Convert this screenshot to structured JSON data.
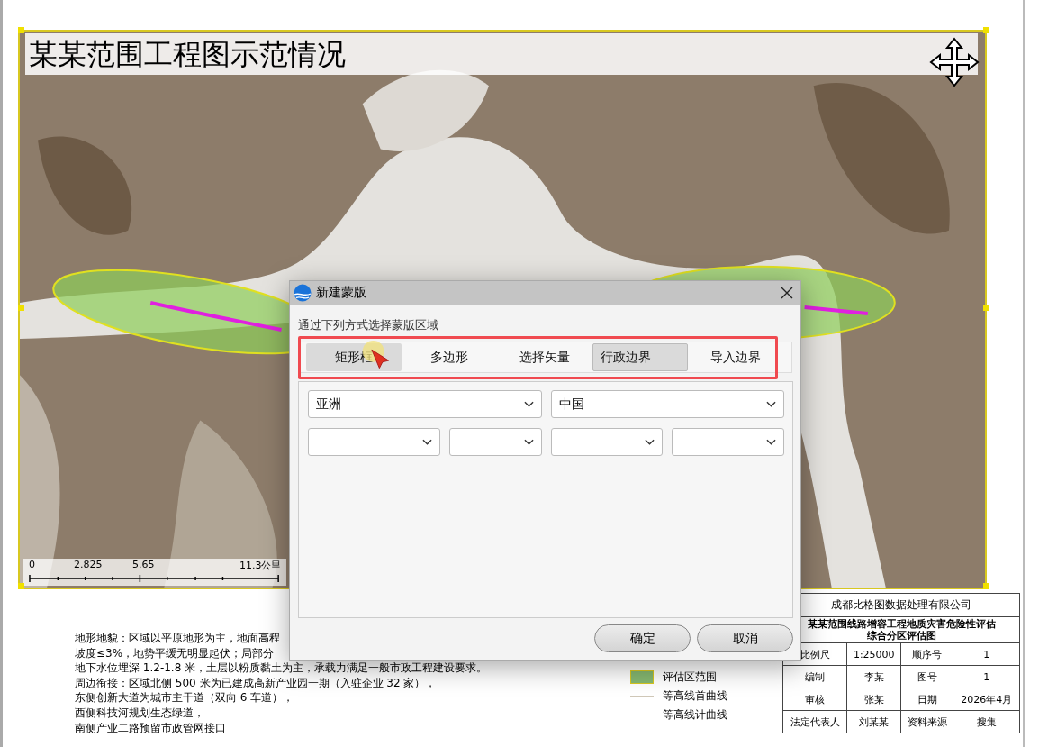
{
  "map_frame": {
    "title": "某某范围工程图示范情况",
    "scale_labels": [
      "0",
      "2.825",
      "5.65",
      "11.3公里"
    ]
  },
  "description": [
    "地形地貌：区域以平原地形为主，地面高程",
    "坡度≤3%，地势平缓无明显起伏；局部分",
    "地下水位埋深 1.2-1.8 米，土层以粉质黏土为主，承载力满足一般市政工程建设要求。",
    "周边衔接：区域北侧 500 米为已建成高新产业园一期（入驻企业 32 家），",
    "东侧创新大道为城市主干道（双向 6 车道），",
    "西侧科技河规划生态绿道，",
    "南侧产业二路预留市政管网接口"
  ],
  "legend": [
    {
      "kind": "area",
      "label": "评估区范围"
    },
    {
      "kind": "minor-contour",
      "label": "等高线首曲线"
    },
    {
      "kind": "major-contour",
      "label": "等高线计曲线"
    }
  ],
  "title_block": {
    "company": "成都比格图数据处理有限公司",
    "map_title": [
      "某某范围线路增容工程地质灾害危险性评估",
      "综合分区评估图"
    ],
    "rows": [
      [
        "比例尺",
        "1:25000",
        "顺序号",
        "1"
      ],
      [
        "编制",
        "李某",
        "图号",
        "1"
      ],
      [
        "审核",
        "张某",
        "日期",
        "2026年4月"
      ],
      [
        "法定代表人",
        "刘某某",
        "资料来源",
        "搜集"
      ]
    ]
  },
  "dialog": {
    "title": "新建蒙版",
    "prompt": "通过下列方式选择蒙版区域",
    "tabs": [
      {
        "label": "矩形框",
        "selected": false,
        "hovered": true
      },
      {
        "label": "多边形",
        "selected": false,
        "hovered": false
      },
      {
        "label": "选择矢量",
        "selected": false,
        "hovered": false
      },
      {
        "label": "行政边界",
        "selected": true,
        "hovered": false
      },
      {
        "label": "导入边界",
        "selected": false,
        "hovered": false
      }
    ],
    "selects": [
      {
        "kind": "filled",
        "value": "亚洲"
      },
      {
        "kind": "filled",
        "value": "中国"
      },
      {
        "kind": "empty"
      },
      {
        "kind": "empty"
      },
      {
        "kind": "empty"
      },
      {
        "kind": "empty"
      }
    ],
    "buttons": [
      "确定",
      "取消"
    ]
  }
}
